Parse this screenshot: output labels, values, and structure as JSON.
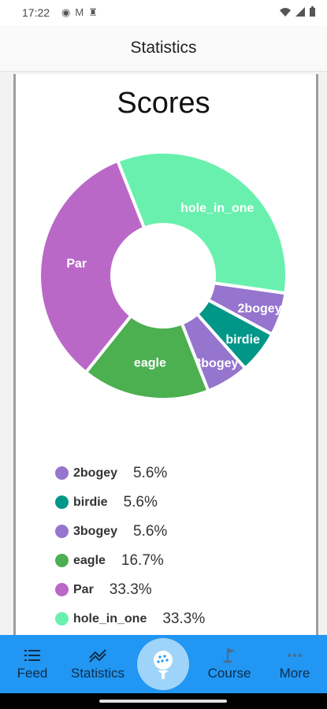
{
  "status_bar": {
    "time": "17:22"
  },
  "appbar": {
    "title": "Statistics"
  },
  "chart": {
    "title": "Scores"
  },
  "chart_data": {
    "type": "pie",
    "title": "Scores",
    "donut": true,
    "segments": [
      {
        "label": "hole_in_one",
        "value": 33.3,
        "color": "#69f0ae"
      },
      {
        "label": "2bogey",
        "value": 5.6,
        "color": "#9575cd"
      },
      {
        "label": "birdie",
        "value": 5.6,
        "color": "#009688"
      },
      {
        "label": "3bogey",
        "value": 5.6,
        "color": "#9575cd"
      },
      {
        "label": "eagle",
        "value": 16.7,
        "color": "#4caf50"
      },
      {
        "label": "Par",
        "value": 33.3,
        "color": "#ba68c8"
      }
    ]
  },
  "legend": [
    {
      "name": "2bogey",
      "pct": "5.6%",
      "color": "#9575cd"
    },
    {
      "name": "birdie",
      "pct": "5.6%",
      "color": "#009688"
    },
    {
      "name": "3bogey",
      "pct": "5.6%",
      "color": "#9575cd"
    },
    {
      "name": "eagle",
      "pct": "16.7%",
      "color": "#4caf50"
    },
    {
      "name": "Par",
      "pct": "33.3%",
      "color": "#ba68c8"
    },
    {
      "name": "hole_in_one",
      "pct": "33.3%",
      "color": "#69f0ae"
    }
  ],
  "nav": {
    "feed": {
      "label": "Feed",
      "icon": "list-icon"
    },
    "statistics": {
      "label": "Statistics",
      "icon": "trending-icon"
    },
    "center": {
      "icon": "golf-ball-tee-icon"
    },
    "course": {
      "label": "Course",
      "icon": "golf-flag-icon"
    },
    "more": {
      "label": "More",
      "icon": "more-dots-icon"
    }
  },
  "colors": {
    "nav_bg": "#2196f3",
    "nav_fg": "#0f2e4a",
    "center_button": "#9fd4fa"
  }
}
